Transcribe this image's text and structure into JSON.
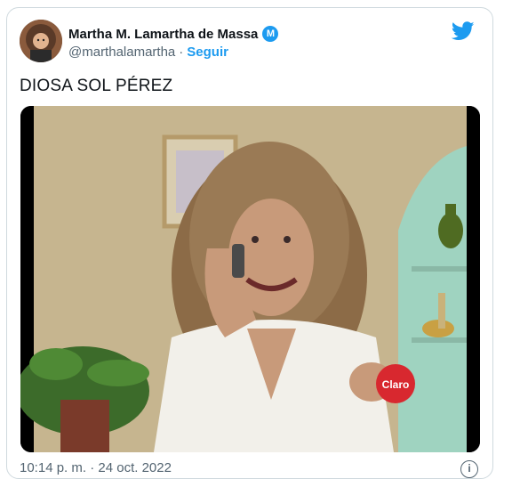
{
  "tweet": {
    "author": {
      "display_name": "Martha M. Lamartha de Massa",
      "badge_letter": "M",
      "handle": "@marthalamartha",
      "separator": "·",
      "follow_label": "Seguir"
    },
    "text": "DIOSA SOL PÉREZ",
    "media": {
      "logo_text": "Claro"
    },
    "timestamp": "10:14 p. m. · 24 oct. 2022",
    "info_symbol": "i"
  },
  "colors": {
    "accent": "#1d9bf0",
    "text_primary": "#0f1419",
    "text_secondary": "#536471",
    "border": "#cfd9de"
  },
  "icons": [
    "twitter-bird-icon",
    "verified-badge-icon",
    "info-icon"
  ]
}
